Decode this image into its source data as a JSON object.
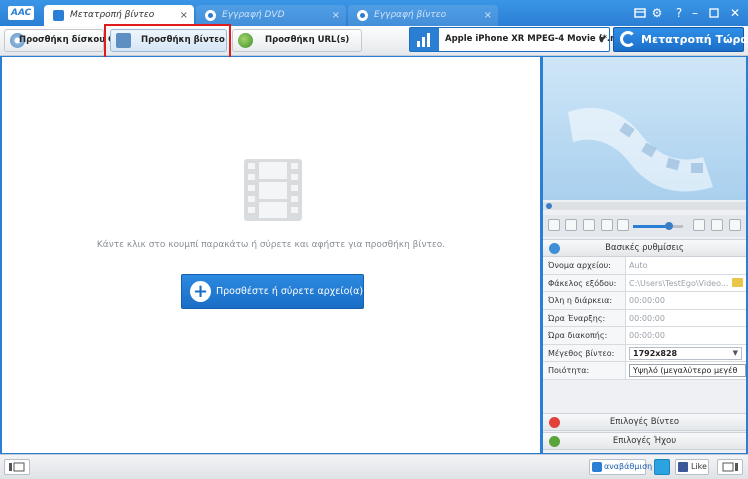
{
  "app": {
    "logo": "AAC"
  },
  "tabs": [
    {
      "label": "Μετατροπή βίντεο",
      "active": true
    },
    {
      "label": "Εγγραφή DVD",
      "active": false
    },
    {
      "label": "Εγγραφή βίντεο",
      "active": false
    }
  ],
  "window_controls": [
    "cart-icon",
    "gear-icon",
    "help-icon",
    "minimize-icon",
    "maximize-icon",
    "close-icon"
  ],
  "toolbar": {
    "add_cd_label": "Προσθήκη δίσκου CD",
    "add_video_label": "Προσθήκη βίντεο",
    "add_url_label": "Προσθήκη URL(s)",
    "profile": "Apple iPhone XR MPEG-4 Movie (*.m...",
    "convert_label": "Μετατροπή Τώρα!"
  },
  "main": {
    "drop_hint": "Κάντε κλικ στο κουμπί παρακάτω ή σύρετε και αφήστε για προσθήκη βίντεο.",
    "add_file_label": "Προσθέστε ή σύρετε αρχείο(α)"
  },
  "settings": {
    "title": "Βασικές ρυθμίσεις",
    "rows": [
      {
        "key": "Όνομα αρχείου:",
        "value": "Auto"
      },
      {
        "key": "Φάκελος εξόδου:",
        "value": "C:\\Users\\TestEgo\\Video..."
      },
      {
        "key": "Όλη η διάρκεια:",
        "value": "00:00:00"
      },
      {
        "key": "Ώρα Έναρξης:",
        "value": "00:00:00"
      },
      {
        "key": "Ώρα διακοπής:",
        "value": "00:00:00"
      },
      {
        "key": "Μέγεθος βίντεο:",
        "value": "1792x828"
      },
      {
        "key": "Ποιότητα:",
        "value": "Υψηλό (μεγαλύτερο μεγέθ"
      }
    ],
    "video_options": "Επιλογές Βίντεο",
    "audio_options": "Επιλογές Ήχου"
  },
  "status": {
    "upgrade_label": "αναβάθμιση",
    "like_label": "Like"
  },
  "colors": {
    "accent": "#2a7fd4",
    "highlight": "#e01b1b"
  }
}
